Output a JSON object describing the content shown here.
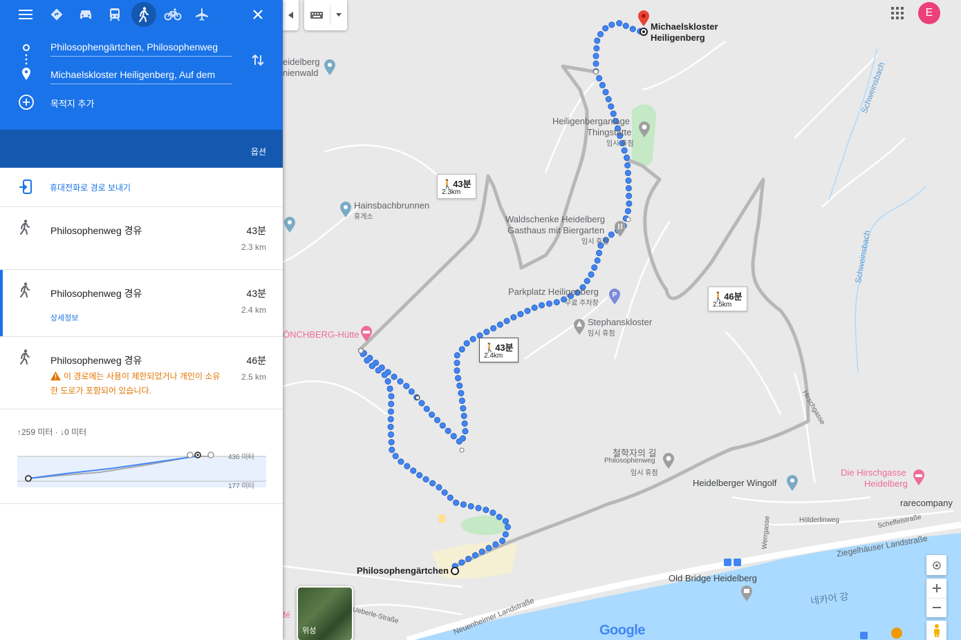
{
  "header": {
    "origin": "Philosophengärtchen, Philosophenweg",
    "destination": "Michaelskloster Heiligenberg, Auf dem",
    "add_destination": "목적지 추가",
    "options": "옵션"
  },
  "send_to_phone": "휴대전화로 경로 보내기",
  "routes": [
    {
      "name": "Philosophenweg 경유",
      "time": "43분",
      "distance": "2.3 km"
    },
    {
      "name": "Philosophenweg 경유",
      "time": "43분",
      "distance": "2.4 km",
      "details": "상세정보"
    },
    {
      "name": "Philosophenweg 경유",
      "time": "46분",
      "distance": "2.5 km",
      "warning": "이 경로에는 사용이 제한되었거나 개인이 소유한 도로가 포함되어 있습니다."
    }
  ],
  "elevation": {
    "summary": "↑259 미터 · ↓0 미터",
    "max": "436 미터",
    "min": "177 미터"
  },
  "map": {
    "user_initial": "E",
    "satellite": "위성",
    "google": "Google",
    "route_boxes": [
      {
        "time": "43분",
        "km": "2.3km"
      },
      {
        "time": "43분",
        "km": "2.4km"
      },
      {
        "time": "46분",
        "km": "2.5km"
      }
    ],
    "places": {
      "destination": "Michaelskloster",
      "destination2": "Heiligenberg",
      "origin": "Philosophengärtchen",
      "heidelberg_forest1": "eidelberg",
      "heidelberg_forest2": "nienwald",
      "thingstaette1": "Heiligenberganlage",
      "thingstaette2": "Thingstätte",
      "thingstaette3": "임시 휴점",
      "hainsbach": "Hainsbachbrunnen",
      "hainsbach2": "휴게소",
      "waldschenke1": "Waldschenke Heidelberg",
      "waldschenke2": "Gasthaus mit Biergarten",
      "waldschenke3": "임시 휴점",
      "parkplatz": "Parkplatz Heiligenberg",
      "parkplatz2": "무료 주차장",
      "stephan": "Stephanskloster",
      "stephan2": "임시 휴점",
      "moenchberg": "ÖNCHBERG-Hütte",
      "philosophenweg1": "철학자의 길",
      "philosophenweg2": "Philosophenweg",
      "philosophenweg3": "임시 휴점",
      "wingolf": "Heidelberger Wingolf",
      "hirschgasse1": "Die Hirschgasse",
      "hirschgasse2": "Heidelberg",
      "rarecompany": "rarecompany",
      "hoelderlin": "Hölderlinweg",
      "scheffel": "Scheffelstraße",
      "ziegel": "Ziegelhäuser Landstraße",
      "oldbridge": "Old Bridge Heidelberg",
      "neckar": "네카어 강",
      "neuenheimer": "Neuenheimer Landstraße",
      "ueberle": "Ueberle-Straße",
      "hirschgasse_st": "Hirschgasse",
      "werrgasse": "Werrgasse",
      "schweinsbach1": "Schweinsbach",
      "schweinsbach2": "Schweinsbach",
      "fe": "fé"
    }
  },
  "colors": {
    "blue": "#1a73e8",
    "route_dot": "#4285f4",
    "alt_route": "#b7b7b7",
    "water": "#aadaff",
    "pin": "#ea4335"
  }
}
